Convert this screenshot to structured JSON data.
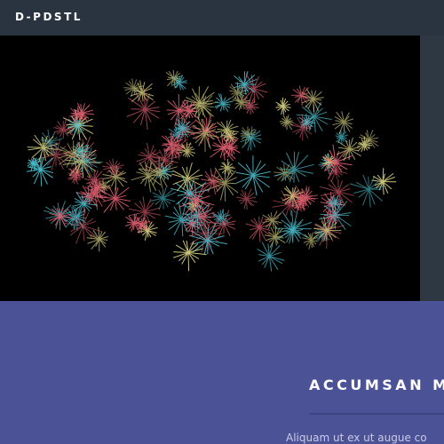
{
  "header": {
    "site_title": "D-PDSTL"
  },
  "banner": {
    "image_icon": "fireworks-photo"
  },
  "section": {
    "heading": "ACCUMSAN M",
    "body_text": "Aliquam ut ex ut augue co"
  },
  "colors": {
    "header_bg": "#2a3440",
    "section_bg": "#4c5296",
    "divider": "#3f4583",
    "firework_red": "#e06070",
    "firework_cyan": "#4cc0d0",
    "firework_yellow": "#d6d080"
  }
}
